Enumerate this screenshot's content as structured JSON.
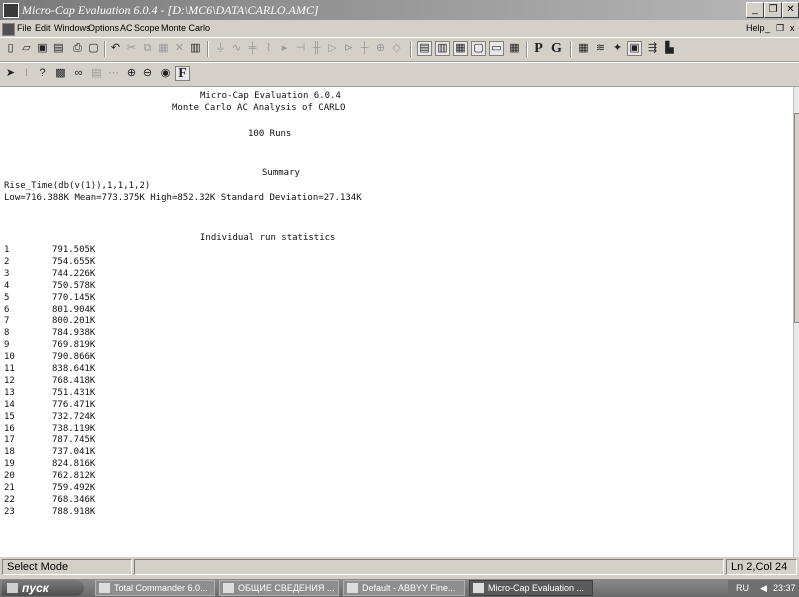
{
  "window": {
    "title": "Micro-Cap Evaluation 6.0.4 - [D:\\MC6\\DATA\\CARLO.AMC]"
  },
  "menu": {
    "items": [
      "File",
      "Edit",
      "Windows",
      "Options",
      "AC",
      "Scope",
      "Monte Carlo"
    ],
    "help": "Help"
  },
  "toolbar2": {
    "f_button": "F"
  },
  "toolbar1": {
    "p_button": "P",
    "g_button": "G"
  },
  "output": {
    "line1": "Micro-Cap Evaluation 6.0.4",
    "line2": "Monte Carlo AC Analysis of CARLO",
    "runs": "100 Runs",
    "summary_header": "Summary",
    "expression": "Rise_Time(db(v(1)),1,1,1,2)",
    "stats": "Low=716.388K Mean=773.375K High=852.32K Standard Deviation=27.134K",
    "individual_header": "Individual run statistics",
    "runs_list": [
      {
        "n": "1",
        "v": "791.505K"
      },
      {
        "n": "2",
        "v": "754.655K"
      },
      {
        "n": "3",
        "v": "744.226K"
      },
      {
        "n": "4",
        "v": "750.578K"
      },
      {
        "n": "5",
        "v": "770.145K"
      },
      {
        "n": "6",
        "v": "801.904K"
      },
      {
        "n": "7",
        "v": "800.201K"
      },
      {
        "n": "8",
        "v": "784.938K"
      },
      {
        "n": "9",
        "v": "769.819K"
      },
      {
        "n": "10",
        "v": "790.866K"
      },
      {
        "n": "11",
        "v": "838.641K"
      },
      {
        "n": "12",
        "v": "768.418K"
      },
      {
        "n": "13",
        "v": "751.431K"
      },
      {
        "n": "14",
        "v": "776.471K"
      },
      {
        "n": "15",
        "v": "732.724K"
      },
      {
        "n": "16",
        "v": "738.119K"
      },
      {
        "n": "17",
        "v": "787.745K"
      },
      {
        "n": "18",
        "v": "737.041K"
      },
      {
        "n": "19",
        "v": "824.816K"
      },
      {
        "n": "20",
        "v": "762.812K"
      },
      {
        "n": "21",
        "v": "759.492K"
      },
      {
        "n": "22",
        "v": "768.346K"
      },
      {
        "n": "23",
        "v": "788.918K"
      }
    ]
  },
  "status": {
    "mode": "Select Mode",
    "position": "Ln 2,Col 24"
  },
  "taskbar": {
    "start": "пуск",
    "tasks": [
      "Total Commander 6.0...",
      "ОБЩИЕ СВЕДЕНИЯ ...",
      "Default - ABBYY Fine...",
      "Micro-Cap Evaluation ..."
    ],
    "lang": "RU",
    "clock": "23:37"
  }
}
